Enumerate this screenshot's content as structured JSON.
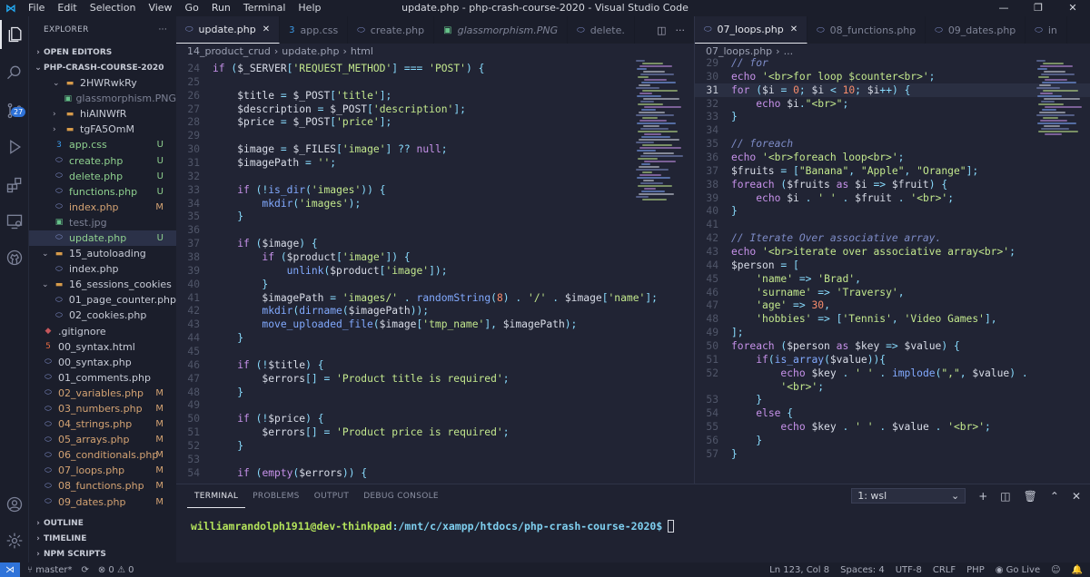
{
  "window": {
    "title": "update.php - php-crash-course-2020 - Visual Studio Code",
    "controls": [
      "—",
      "❐",
      "✕"
    ]
  },
  "menu": [
    "File",
    "Edit",
    "Selection",
    "View",
    "Go",
    "Run",
    "Terminal",
    "Help"
  ],
  "activity": {
    "badge": "27"
  },
  "sidebar": {
    "title": "EXPLORER",
    "more": "···",
    "open_editors": "OPEN EDITORS",
    "project": "PHP-CRASH-COURSE-2020",
    "tree": [
      {
        "label": "2HWRwkRy",
        "icon": "folder",
        "depth": 1,
        "open": true
      },
      {
        "label": "glassmorphism.PNG",
        "icon": "image",
        "depth": 2,
        "dim": true
      },
      {
        "label": "hiAINWfR",
        "icon": "folder",
        "depth": 1,
        "open": false
      },
      {
        "label": "tgFA5OmM",
        "icon": "folder",
        "depth": 1,
        "open": false
      },
      {
        "label": "app.css",
        "icon": "css",
        "depth": 1,
        "status": "U"
      },
      {
        "label": "create.php",
        "icon": "php",
        "depth": 1,
        "status": "U"
      },
      {
        "label": "delete.php",
        "icon": "php",
        "depth": 1,
        "status": "U"
      },
      {
        "label": "functions.php",
        "icon": "php",
        "depth": 1,
        "status": "U"
      },
      {
        "label": "index.php",
        "icon": "php",
        "depth": 1,
        "status": "M"
      },
      {
        "label": "test.jpg",
        "icon": "image",
        "depth": 1,
        "dim": true
      },
      {
        "label": "update.php",
        "icon": "php",
        "depth": 1,
        "status": "U",
        "selected": true
      },
      {
        "label": "15_autoloading",
        "icon": "folder",
        "depth": 0,
        "open": true
      },
      {
        "label": "index.php",
        "icon": "php",
        "depth": 1
      },
      {
        "label": "16_sessions_cookies",
        "icon": "folder",
        "depth": 0,
        "open": true
      },
      {
        "label": "01_page_counter.php",
        "icon": "php",
        "depth": 1
      },
      {
        "label": "02_cookies.php",
        "icon": "php",
        "depth": 1
      },
      {
        "label": ".gitignore",
        "icon": "git",
        "depth": 0
      },
      {
        "label": "00_syntax.html",
        "icon": "html",
        "depth": 0
      },
      {
        "label": "00_syntax.php",
        "icon": "php",
        "depth": 0
      },
      {
        "label": "01_comments.php",
        "icon": "php",
        "depth": 0
      },
      {
        "label": "02_variables.php",
        "icon": "php",
        "depth": 0,
        "status": "M"
      },
      {
        "label": "03_numbers.php",
        "icon": "php",
        "depth": 0,
        "status": "M"
      },
      {
        "label": "04_strings.php",
        "icon": "php",
        "depth": 0,
        "status": "M"
      },
      {
        "label": "05_arrays.php",
        "icon": "php",
        "depth": 0,
        "status": "M"
      },
      {
        "label": "06_conditionals.php",
        "icon": "php",
        "depth": 0,
        "status": "M"
      },
      {
        "label": "07_loops.php",
        "icon": "php",
        "depth": 0,
        "status": "M"
      },
      {
        "label": "08_functions.php",
        "icon": "php",
        "depth": 0,
        "status": "M"
      },
      {
        "label": "09_dates.php",
        "icon": "php",
        "depth": 0,
        "status": "M"
      }
    ],
    "bottom": [
      "OUTLINE",
      "TIMELINE",
      "NPM SCRIPTS"
    ]
  },
  "editor1": {
    "tabs": [
      {
        "label": "update.php",
        "icon": "php",
        "active": true,
        "close": "✕"
      },
      {
        "label": "app.css",
        "icon": "css"
      },
      {
        "label": "create.php",
        "icon": "php"
      },
      {
        "label": "glassmorphism.PNG",
        "icon": "image",
        "italic": true
      },
      {
        "label": "delete.",
        "icon": "php"
      }
    ],
    "breadcrumb": [
      "14_product_crud",
      "update.php",
      "html"
    ],
    "lines": [
      {
        "no": "24",
        "code": "if ($_SERVER['REQUEST_METHOD'] === 'POST') {"
      },
      {
        "no": "25",
        "code": ""
      },
      {
        "no": "26",
        "code": "    $title = $_POST['title'];"
      },
      {
        "no": "27",
        "code": "    $description = $_POST['description'];"
      },
      {
        "no": "28",
        "code": "    $price = $_POST['price'];"
      },
      {
        "no": "29",
        "code": ""
      },
      {
        "no": "30",
        "code": "    $image = $_FILES['image'] ?? null;"
      },
      {
        "no": "31",
        "code": "    $imagePath = '';"
      },
      {
        "no": "32",
        "code": ""
      },
      {
        "no": "33",
        "code": "    if (!is_dir('images')) {"
      },
      {
        "no": "34",
        "code": "        mkdir('images');"
      },
      {
        "no": "35",
        "code": "    }"
      },
      {
        "no": "36",
        "code": ""
      },
      {
        "no": "37",
        "code": "    if ($image) {"
      },
      {
        "no": "38",
        "code": "        if ($product['image']) {"
      },
      {
        "no": "39",
        "code": "            unlink($product['image']);"
      },
      {
        "no": "40",
        "code": "        }"
      },
      {
        "no": "41",
        "code": "        $imagePath = 'images/' . randomString(8) . '/' . $image['name'];"
      },
      {
        "no": "42",
        "code": "        mkdir(dirname($imagePath));"
      },
      {
        "no": "43",
        "code": "        move_uploaded_file($image['tmp_name'], $imagePath);"
      },
      {
        "no": "44",
        "code": "    }"
      },
      {
        "no": "45",
        "code": ""
      },
      {
        "no": "46",
        "code": "    if (!$title) {"
      },
      {
        "no": "47",
        "code": "        $errors[] = 'Product title is required';"
      },
      {
        "no": "48",
        "code": "    }"
      },
      {
        "no": "49",
        "code": ""
      },
      {
        "no": "50",
        "code": "    if (!$price) {"
      },
      {
        "no": "51",
        "code": "        $errors[] = 'Product price is required';"
      },
      {
        "no": "52",
        "code": "    }"
      },
      {
        "no": "53",
        "code": ""
      },
      {
        "no": "54",
        "code": "    if (empty($errors)) {"
      }
    ]
  },
  "editor2": {
    "tabs": [
      {
        "label": "07_loops.php",
        "icon": "php",
        "active": true,
        "close": "✕"
      },
      {
        "label": "08_functions.php",
        "icon": "php"
      },
      {
        "label": "09_dates.php",
        "icon": "php"
      },
      {
        "label": "in",
        "icon": "php"
      }
    ],
    "breadcrumb": [
      "07_loops.php",
      "..."
    ],
    "current_line": "31",
    "lines": [
      {
        "no": "29",
        "code": "// for"
      },
      {
        "no": "30",
        "code": "echo '<br>for loop $counter<br>';"
      },
      {
        "no": "31",
        "code": "for ($i = 0; $i < 10; $i++) {"
      },
      {
        "no": "32",
        "code": "    echo $i.\"<br>\";"
      },
      {
        "no": "33",
        "code": "}"
      },
      {
        "no": "34",
        "code": ""
      },
      {
        "no": "35",
        "code": "// foreach"
      },
      {
        "no": "36",
        "code": "echo '<br>foreach loop<br>';"
      },
      {
        "no": "37",
        "code": "$fruits = [\"Banana\", \"Apple\", \"Orange\"];"
      },
      {
        "no": "38",
        "code": "foreach ($fruits as $i => $fruit) {"
      },
      {
        "no": "39",
        "code": "    echo $i . ' ' . $fruit . '<br>';"
      },
      {
        "no": "40",
        "code": "}"
      },
      {
        "no": "41",
        "code": ""
      },
      {
        "no": "42",
        "code": "// Iterate Over associative array."
      },
      {
        "no": "43",
        "code": "echo '<br>iterate over associative array<br>';"
      },
      {
        "no": "44",
        "code": "$person = ["
      },
      {
        "no": "45",
        "code": "    'name' => 'Brad',"
      },
      {
        "no": "46",
        "code": "    'surname' => 'Traversy',"
      },
      {
        "no": "47",
        "code": "    'age' => 30,"
      },
      {
        "no": "48",
        "code": "    'hobbies' => ['Tennis', 'Video Games'],"
      },
      {
        "no": "49",
        "code": "];"
      },
      {
        "no": "50",
        "code": "foreach ($person as $key => $value) {"
      },
      {
        "no": "51",
        "code": "    if(is_array($value)){"
      },
      {
        "no": "52",
        "code": "        echo $key . ' ' . implode(\",\", $value) ."
      },
      {
        "no": "",
        "code": "        '<br>';"
      },
      {
        "no": "53",
        "code": "    }"
      },
      {
        "no": "54",
        "code": "    else {"
      },
      {
        "no": "55",
        "code": "        echo $key . ' ' . $value . '<br>';"
      },
      {
        "no": "56",
        "code": "    }"
      },
      {
        "no": "57",
        "code": "}"
      }
    ]
  },
  "panel": {
    "tabs": [
      "TERMINAL",
      "PROBLEMS",
      "OUTPUT",
      "DEBUG CONSOLE"
    ],
    "terminal_select": "1: wsl",
    "prompt_user": "williamrandolph1911@dev-thinkpad",
    "prompt_path": ":/mnt/c/xampp/htdocs/php-crash-course-2020$"
  },
  "status": {
    "branch": "master*",
    "sync": "⟳",
    "errors": "⊗ 0",
    "warnings": "⚠ 0",
    "position": "Ln 123, Col 8",
    "spaces": "Spaces: 4",
    "encoding": "UTF-8",
    "eol": "CRLF",
    "language": "PHP",
    "golive": "Go Live"
  }
}
